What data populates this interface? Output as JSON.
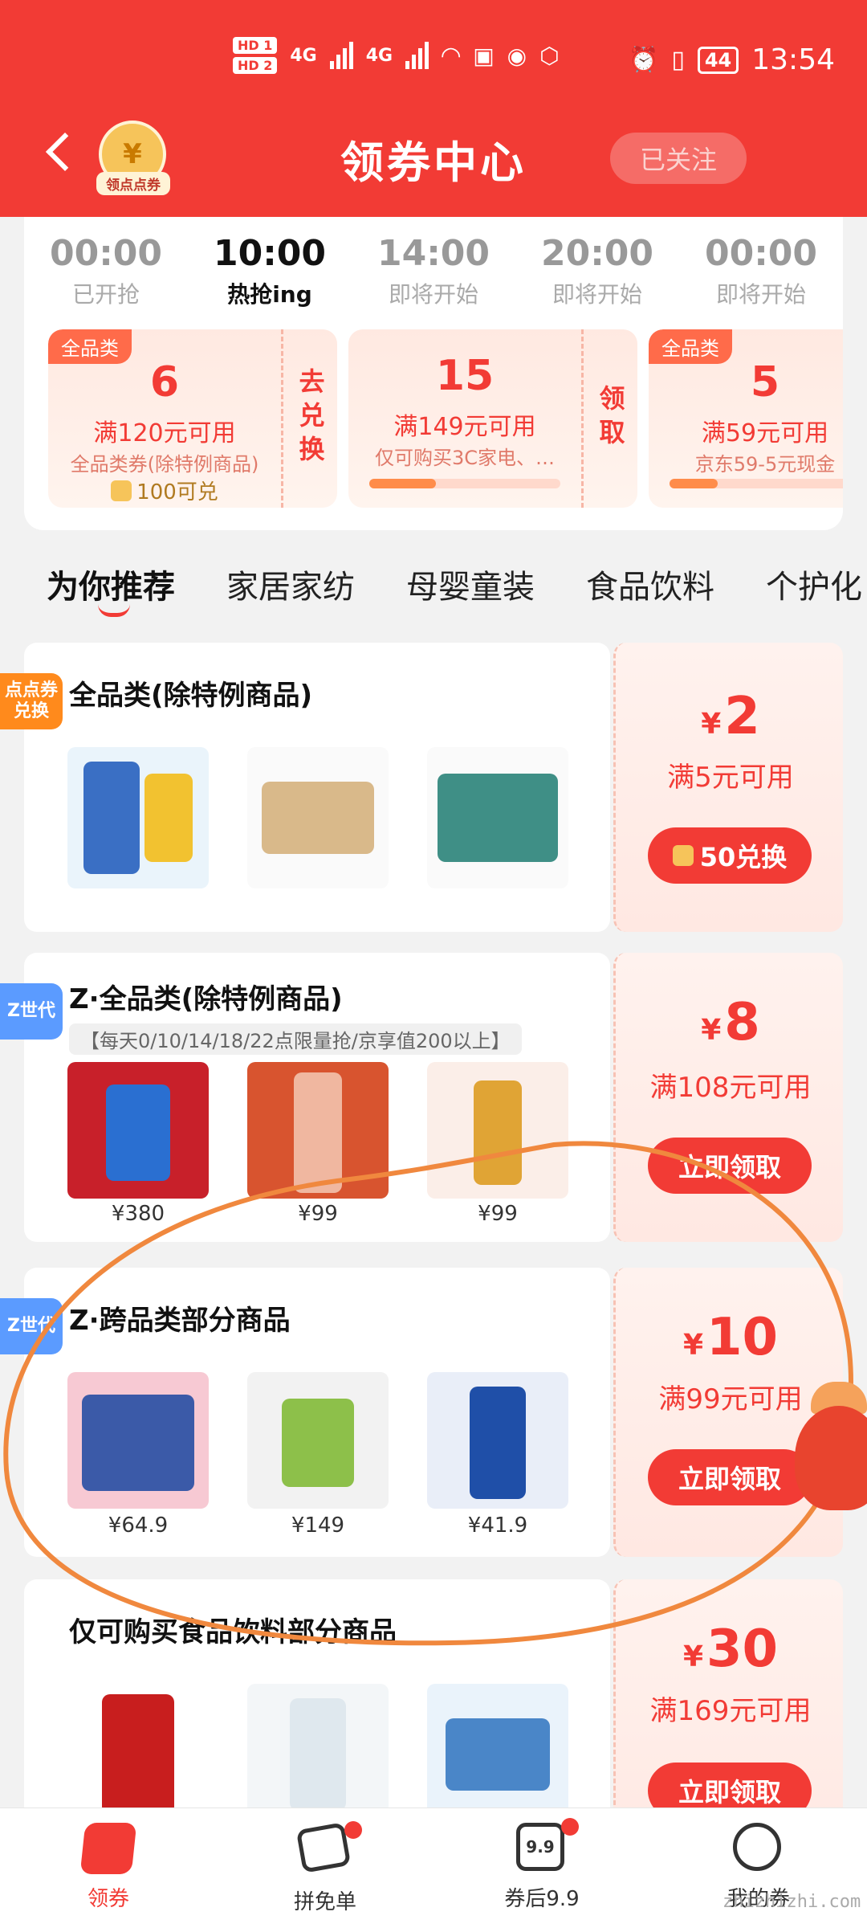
{
  "status_bar": {
    "sim1": "HD 1",
    "sim2": "HD 2",
    "net1": "4G",
    "net2": "4G",
    "battery": "44",
    "time": "13:54"
  },
  "header": {
    "points_label": "领点点券",
    "title": "领券中心",
    "follow_label": "已关注"
  },
  "sessions": [
    {
      "time": "00:00",
      "status": "已开抢"
    },
    {
      "time": "10:00",
      "status": "热抢ing"
    },
    {
      "time": "14:00",
      "status": "即将开始"
    },
    {
      "time": "20:00",
      "status": "即将开始"
    },
    {
      "time": "00:00",
      "status": "即将开始"
    }
  ],
  "top_coupons": [
    {
      "tag": "全品类",
      "amount": "6",
      "condition": "满120元可用",
      "desc": "全品类券(除特例商品)",
      "points": "100可兑",
      "action": "去兑换"
    },
    {
      "amount": "15",
      "condition": "满149元可用",
      "desc": "仅可购买3C家电、…",
      "progress": 0.35,
      "action": "领取"
    },
    {
      "tag": "全品类",
      "amount": "5",
      "condition": "满59元可用",
      "desc": "京东59-5元现金",
      "progress": 0.25
    }
  ],
  "tabs": [
    "为你推荐",
    "家居家纺",
    "母婴童装",
    "食品饮料",
    "个护化"
  ],
  "coupons": [
    {
      "badge": "点点券兑换",
      "title": "全品类(除特例商品)",
      "products": [
        {
          "price": ""
        },
        {
          "price": ""
        },
        {
          "price": ""
        }
      ],
      "currency": "¥",
      "amount": "2",
      "condition": "满5元可用",
      "button": "50兑换"
    },
    {
      "badge": "Z世代",
      "title": "Z·全品类(除特例商品)",
      "note": "【每天0/10/14/18/22点限量抢/京享值200以上】",
      "products": [
        {
          "price": "¥380"
        },
        {
          "price": "¥99"
        },
        {
          "price": "¥99"
        }
      ],
      "currency": "¥",
      "amount": "8",
      "condition": "满108元可用",
      "button": "立即领取"
    },
    {
      "badge": "Z世代",
      "title": "Z·跨品类部分商品",
      "products": [
        {
          "price": "¥64.9"
        },
        {
          "price": "¥149"
        },
        {
          "price": "¥41.9"
        }
      ],
      "currency": "¥",
      "amount": "10",
      "condition": "满99元可用",
      "button": "立即领取"
    },
    {
      "title": "仅可购买食品饮料部分商品",
      "products": [
        {
          "price": ""
        },
        {
          "price": ""
        },
        {
          "price": ""
        }
      ],
      "currency": "¥",
      "amount": "30",
      "condition": "满169元可用",
      "button": "立即领取"
    }
  ],
  "bottom_nav": [
    {
      "label": "领券",
      "icon": "coupon-icon"
    },
    {
      "label": "拼免单",
      "icon": "group-buy-icon"
    },
    {
      "label": "券后9.9",
      "icon": "price-tag-icon",
      "icon_text": "9.9"
    },
    {
      "label": "我的券",
      "icon": "my-coupon-icon"
    }
  ],
  "watermark": "zhizhizhi.com",
  "colors": {
    "brand_red": "#f23b35",
    "annotation": "#f0883e",
    "z_gen_blue": "#5b9bff"
  }
}
